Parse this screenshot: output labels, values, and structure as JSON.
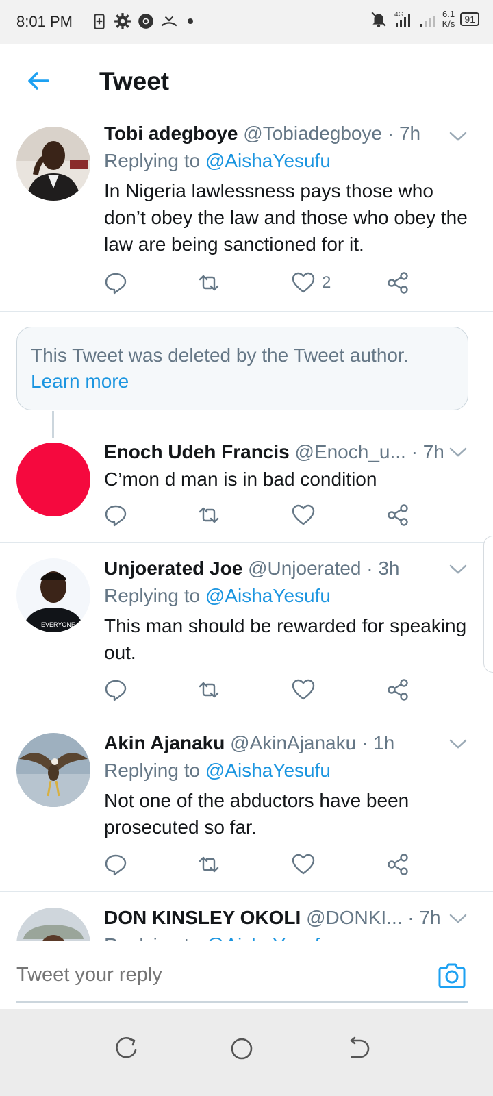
{
  "status_bar": {
    "time": "8:01 PM",
    "network": "4G",
    "speed_value": "6.1",
    "speed_unit": "K/s",
    "battery": "91"
  },
  "header": {
    "title": "Tweet",
    "back_icon": "arrow-left-icon"
  },
  "tweets": [
    {
      "name": "Tobi adegboye",
      "handle": "@Tobiadegboye",
      "time": "· 7h",
      "replying_prefix": "Replying to ",
      "replying_to": "@AishaYesufu",
      "text": "In Nigeria lawlessness pays those who don’t obey the law and those who obey the law are being sanctioned for it.",
      "likes": "2"
    },
    {
      "name": "Enoch Udeh Francis",
      "handle": "@Enoch_u...",
      "time": "· 7h",
      "text": "C’mon d man is in bad condition"
    },
    {
      "name": "Unjoerated Joe",
      "handle": "@Unjoerated",
      "time": "· 3h",
      "replying_prefix": "Replying to ",
      "replying_to": "@AishaYesufu",
      "text": "This man should be rewarded for speaking out.",
      "shirt_text": "EVERYONE"
    },
    {
      "name": "Akin Ajanaku",
      "handle": "@AkinAjanaku",
      "time": "· 1h",
      "replying_prefix": "Replying to ",
      "replying_to": "@AishaYesufu",
      "text": "Not one of the abductors have been prosecuted so far."
    },
    {
      "name": "DON KINSLEY OKOLI",
      "handle": "@DONKI...",
      "time": "· 7h",
      "replying_prefix": "Replying to ",
      "replying_to": "@AishaYesufu"
    }
  ],
  "deleted_notice": {
    "text": "This Tweet was deleted by the Tweet author.",
    "link": "Learn more"
  },
  "reply_bar": {
    "placeholder": "Tweet your reply",
    "camera_icon": "camera-icon"
  },
  "colors": {
    "accent": "#1b95e0",
    "secondary_text": "#657786",
    "divider": "#e1e8ed",
    "enoch_avatar": "#f5093e"
  }
}
